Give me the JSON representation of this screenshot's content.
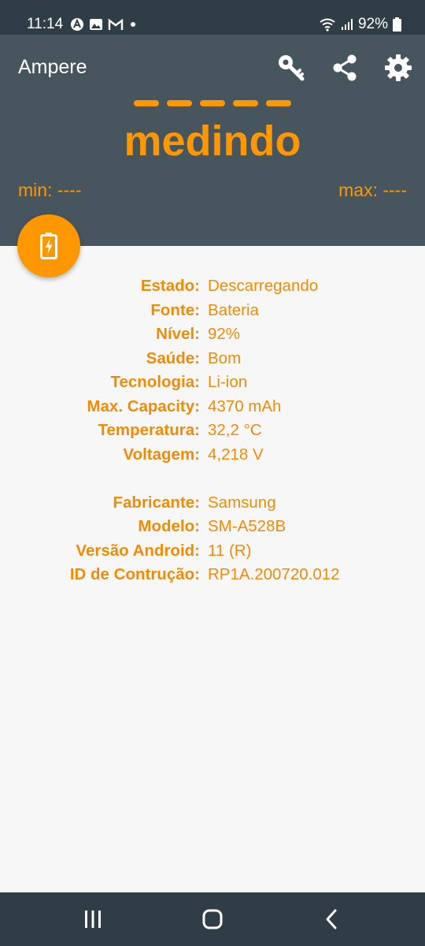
{
  "status_bar": {
    "time": "11:14",
    "battery_percent": "92%",
    "left_icons": [
      "a-notification-icon",
      "gallery-icon",
      "gmail-icon",
      "dot-icon"
    ],
    "right_icons": [
      "wifi-icon",
      "signal-icon",
      "battery-icon"
    ]
  },
  "app_bar": {
    "title": "Ampere",
    "actions": [
      "key-icon",
      "share-icon",
      "gear-icon"
    ],
    "background": "#47555f"
  },
  "measurement": {
    "status_text": "medindo",
    "min": "min: ----",
    "max": "max: ----",
    "accent_color": "#ff9800"
  },
  "fab": {
    "icon": "battery-charging-icon"
  },
  "battery_info": [
    {
      "label": "Estado:",
      "value": "Descarregando"
    },
    {
      "label": "Fonte:",
      "value": "Bateria"
    },
    {
      "label": "Nível:",
      "value": "92%"
    },
    {
      "label": "Saúde:",
      "value": "Bom"
    },
    {
      "label": "Tecnologia:",
      "value": "Li-ion"
    },
    {
      "label": "Max. Capacity:",
      "value": "4370 mAh"
    },
    {
      "label": "Temperatura:",
      "value": "32,2 °C"
    },
    {
      "label": "Voltagem:",
      "value": "4,218 V"
    }
  ],
  "device_info": [
    {
      "label": "Fabricante:",
      "value": "Samsung"
    },
    {
      "label": "Modelo:",
      "value": "SM-A528B"
    },
    {
      "label": "Versão Android:",
      "value": "11 (R)"
    },
    {
      "label": "ID de Contrução:",
      "value": "RP1A.200720.012"
    }
  ],
  "nav_bar": {
    "buttons": [
      "recents-icon",
      "home-icon",
      "back-icon"
    ]
  }
}
